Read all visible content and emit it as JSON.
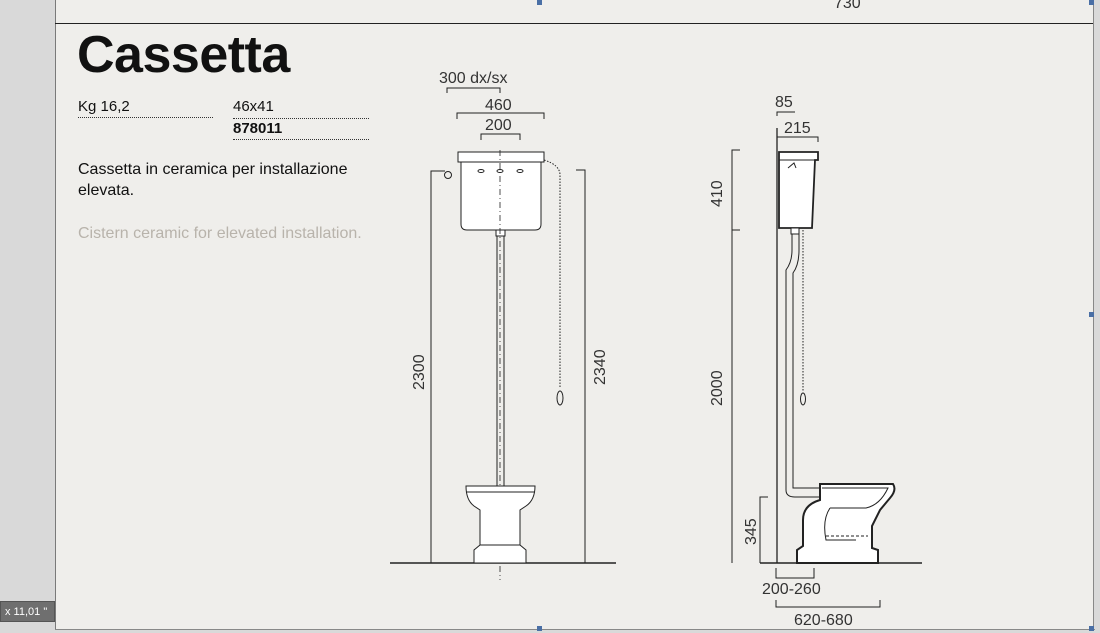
{
  "header": {
    "top_dimension": "730"
  },
  "product": {
    "title": "Cassetta",
    "weight": "Kg 16,2",
    "size": "46x41",
    "code": "878011",
    "description_it": "Cassetta in ceramica per installazione elevata.",
    "description_en": "Cistern ceramic for elevated installation."
  },
  "front_view": {
    "dim_offset": "300 dx/sx",
    "dim_width": "460",
    "dim_inner": "200",
    "dim_height_left": "2300",
    "dim_height_right": "2340"
  },
  "side_view": {
    "dim_top_small": "85",
    "dim_top_width": "215",
    "dim_cistern_height": "410",
    "dim_elevation": "2000",
    "dim_bowl_height": "345",
    "dim_outlet": "200-260",
    "dim_depth": "620-680"
  },
  "status_bar": {
    "dimension_readout": "x 11,01 \""
  }
}
